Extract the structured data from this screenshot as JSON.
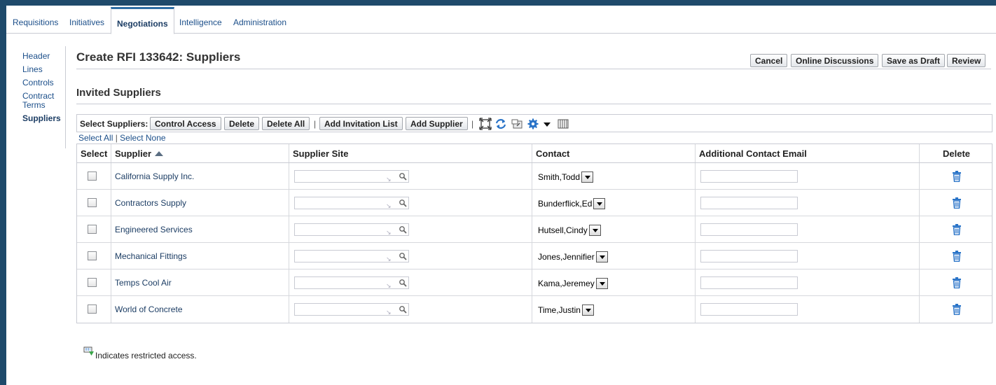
{
  "tabs": [
    "Requisitions",
    "Initiatives",
    "Negotiations",
    "Intelligence",
    "Administration"
  ],
  "active_tab": "Negotiations",
  "nav": [
    "Header",
    "Lines",
    "Controls",
    "Contract Terms",
    "Suppliers"
  ],
  "active_nav": "Suppliers",
  "page_title": "Create RFI 133642: Suppliers",
  "actions": {
    "cancel": "Cancel",
    "online_discussions": "Online Discussions",
    "save_as_draft": "Save as Draft",
    "review": "Review"
  },
  "section_title": "Invited Suppliers",
  "toolbar": {
    "label": "Select Suppliers:",
    "control_access": "Control Access",
    "delete": "Delete",
    "delete_all": "Delete All",
    "add_invitation_list": "Add Invitation List",
    "add_supplier": "Add Supplier",
    "separator": "|"
  },
  "select_links": {
    "select_all": "Select All",
    "sep": "|",
    "select_none": "Select None"
  },
  "table": {
    "headers": {
      "select": "Select",
      "supplier": "Supplier",
      "site": "Supplier Site",
      "contact": "Contact",
      "email": "Additional Contact Email",
      "delete": "Delete"
    },
    "rows": [
      {
        "supplier": "California Supply Inc.",
        "contact": "Smith,Todd"
      },
      {
        "supplier": "Contractors Supply",
        "contact": "Bunderflick,Ed"
      },
      {
        "supplier": "Engineered Services",
        "contact": "Hutsell,Cindy"
      },
      {
        "supplier": "Mechanical Fittings",
        "contact": "Jones,Jennifier"
      },
      {
        "supplier": "Temps Cool Air",
        "contact": "Kama,Jeremey"
      },
      {
        "supplier": "World of Concrete",
        "contact": "Time,Justin"
      }
    ]
  },
  "footnote": "Indicates restricted access.",
  "icons": [
    "detach-icon",
    "refresh-icon",
    "export-icon",
    "settings-icon",
    "columns-icon",
    "search-icon",
    "trash-icon",
    "restricted-access-icon"
  ],
  "colors": {
    "header_bar": "#1f4a6b",
    "link": "#1c4f8a",
    "icon_blue": "#2a74c8"
  }
}
